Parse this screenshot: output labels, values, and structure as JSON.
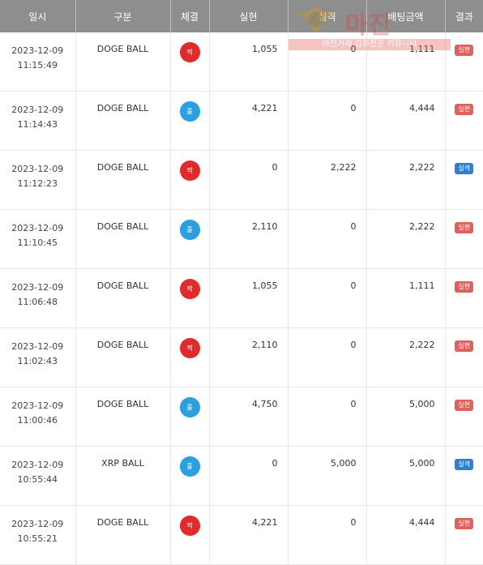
{
  "table": {
    "headers": {
      "time": "일시",
      "type": "구분",
      "bet": "체결",
      "win": "실현",
      "loss": "실격",
      "amount": "배팅금액",
      "result": "결과"
    },
    "rows": [
      {
        "date": "2023-12-09",
        "time": "11:15:49",
        "type": "DOGE BALL",
        "bet": "짝",
        "bet_color": "red",
        "win": "1,055",
        "loss": "0",
        "amount": "1,111",
        "result": "실현",
        "result_color": "red"
      },
      {
        "date": "2023-12-09",
        "time": "11:14:43",
        "type": "DOGE BALL",
        "bet": "홀",
        "bet_color": "blue",
        "win": "4,221",
        "loss": "0",
        "amount": "4,444",
        "result": "실현",
        "result_color": "red"
      },
      {
        "date": "2023-12-09",
        "time": "11:12:23",
        "type": "DOGE BALL",
        "bet": "짝",
        "bet_color": "red",
        "win": "0",
        "loss": "2,222",
        "amount": "2,222",
        "result": "실격",
        "result_color": "blue"
      },
      {
        "date": "2023-12-09",
        "time": "11:10:45",
        "type": "DOGE BALL",
        "bet": "홀",
        "bet_color": "blue",
        "win": "2,110",
        "loss": "0",
        "amount": "2,222",
        "result": "실현",
        "result_color": "red"
      },
      {
        "date": "2023-12-09",
        "time": "11:06:48",
        "type": "DOGE BALL",
        "bet": "짝",
        "bet_color": "red",
        "win": "1,055",
        "loss": "0",
        "amount": "1,111",
        "result": "실현",
        "result_color": "red"
      },
      {
        "date": "2023-12-09",
        "time": "11:02:43",
        "type": "DOGE BALL",
        "bet": "짝",
        "bet_color": "red",
        "win": "2,110",
        "loss": "0",
        "amount": "2,222",
        "result": "실현",
        "result_color": "red"
      },
      {
        "date": "2023-12-09",
        "time": "11:00:46",
        "type": "DOGE BALL",
        "bet": "홀",
        "bet_color": "blue",
        "win": "4,750",
        "loss": "0",
        "amount": "5,000",
        "result": "실현",
        "result_color": "red"
      },
      {
        "date": "2023-12-09",
        "time": "10:55:44",
        "type": "XRP BALL",
        "bet": "홀",
        "bet_color": "blue",
        "win": "0",
        "loss": "5,000",
        "amount": "5,000",
        "result": "실격",
        "result_color": "blue"
      },
      {
        "date": "2023-12-09",
        "time": "10:55:21",
        "type": "DOGE BALL",
        "bet": "짝",
        "bet_color": "red",
        "win": "4,221",
        "loss": "0",
        "amount": "4,444",
        "result": "실현",
        "result_color": "red"
      }
    ]
  },
  "watermark": {
    "title": "마진",
    "subtitle": "마진거래 검증전문 커뮤니티"
  },
  "colors": {
    "header_bg": "#8e8e8e",
    "odd_blue": "#2b9fe0",
    "even_red": "#e12a2a",
    "badge_win": "#e0605e",
    "badge_loss": "#2f7fd4"
  }
}
